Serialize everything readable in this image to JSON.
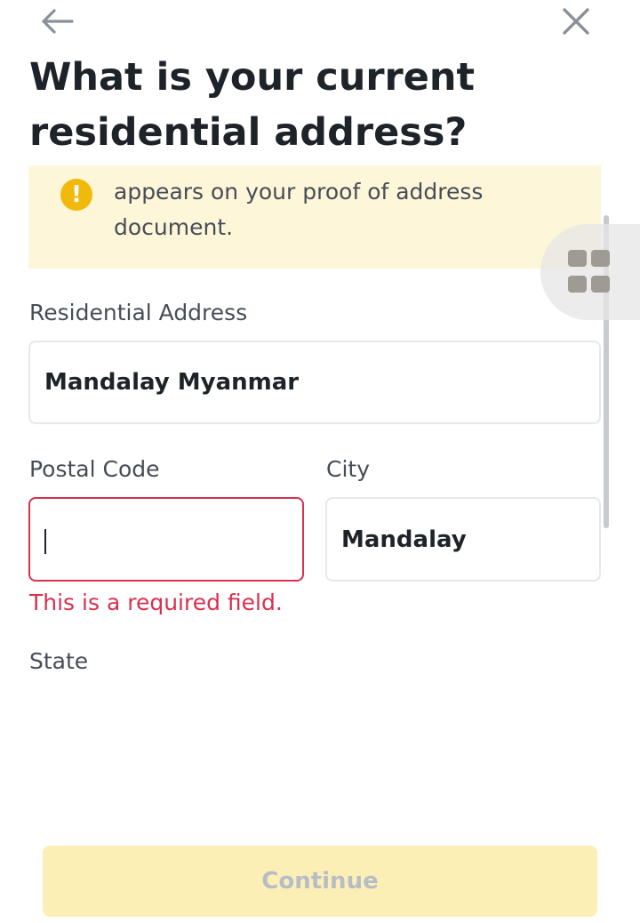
{
  "header": {
    "title": "What is your current residential address?"
  },
  "notice": {
    "text": "appears on your proof of address document.",
    "icon_glyph": "!",
    "icon": "warning-icon",
    "background": "#fdf6d8",
    "icon_color": "#f0b90b"
  },
  "form": {
    "residential_address": {
      "label": "Residential Address",
      "value": "Mandalay Myanmar"
    },
    "postal_code": {
      "label": "Postal Code",
      "value": "",
      "error": "This is a required field."
    },
    "city": {
      "label": "City",
      "value": "Mandalay"
    },
    "state": {
      "label": "State"
    }
  },
  "footer": {
    "continue_label": "Continue"
  },
  "colors": {
    "error": "#d9304e",
    "brand": "#f0b90b",
    "disabled_button_bg": "#fcefb6",
    "disabled_button_text": "#b7bdc6"
  },
  "icons": {
    "back": "back-arrow-icon",
    "close": "close-icon",
    "floating": "grid-icon"
  }
}
